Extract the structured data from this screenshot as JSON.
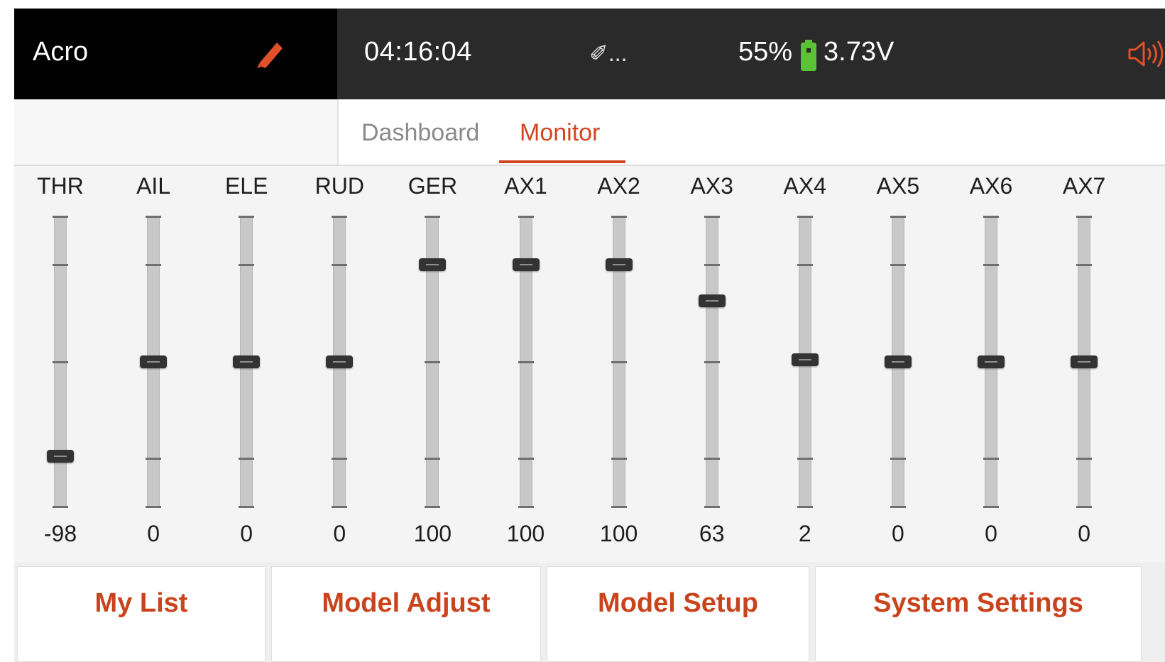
{
  "header": {
    "model_name": "Acro",
    "timer": "04:16:04",
    "link_status": "✐...",
    "battery_percent": "55%",
    "battery_voltage": "3.73V",
    "icons": [
      "pencil-icon",
      "battery-icon",
      "volume-icon"
    ]
  },
  "tabs": [
    {
      "label": "Dashboard",
      "active": false
    },
    {
      "label": "Monitor",
      "active": true
    }
  ],
  "channels": [
    {
      "label": "THR",
      "value": "-98"
    },
    {
      "label": "AIL",
      "value": "0"
    },
    {
      "label": "ELE",
      "value": "0"
    },
    {
      "label": "RUD",
      "value": "0"
    },
    {
      "label": "GER",
      "value": "100"
    },
    {
      "label": "AX1",
      "value": "100"
    },
    {
      "label": "AX2",
      "value": "100"
    },
    {
      "label": "AX3",
      "value": "63"
    },
    {
      "label": "AX4",
      "value": "2"
    },
    {
      "label": "AX5",
      "value": "0"
    },
    {
      "label": "AX6",
      "value": "0"
    },
    {
      "label": "AX7",
      "value": "0"
    }
  ],
  "bottom_nav": [
    "My List",
    "Model Adjust",
    "Model Setup",
    "System Settings"
  ],
  "colors": {
    "accent": "#d2461f",
    "header_bg": "#2a2a2a",
    "model_bg": "#000000",
    "battery_green": "#5bc236"
  }
}
